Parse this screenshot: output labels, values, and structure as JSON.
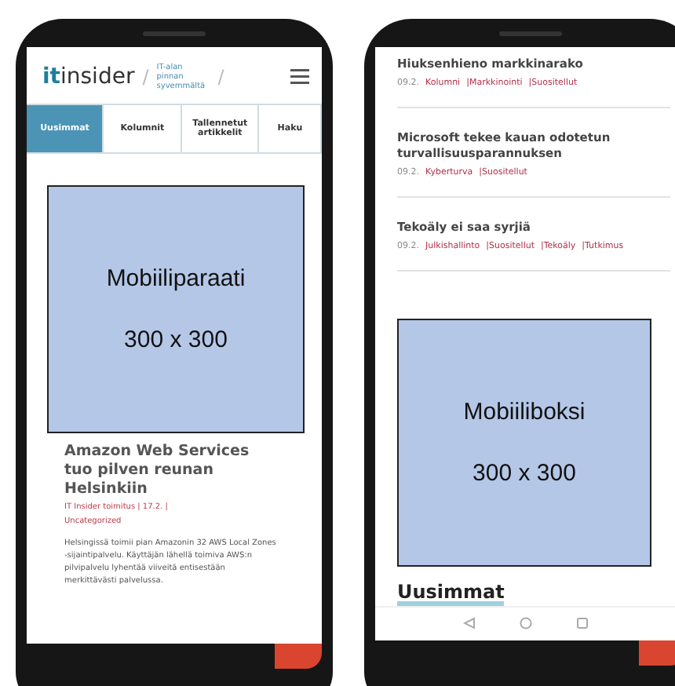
{
  "left_phone": {
    "header": {
      "logo_mark": "it",
      "logo_word": "insider",
      "separators": [
        "/",
        "/"
      ],
      "tagline": "IT-alan pinnan syvemmältä"
    },
    "tabs": [
      {
        "label": "Uusimmat",
        "selected": true
      },
      {
        "label": "Kolumnit",
        "selected": false
      },
      {
        "label": "Tallennetut artikkelit",
        "selected": false
      },
      {
        "label": "Haku",
        "selected": false
      }
    ],
    "ad": {
      "name": "Mobiiliparaati",
      "size": "300 x 300"
    },
    "article": {
      "title": "Amazon Web Services tuo pilven reunan Helsinkiin",
      "meta": "IT Insider toimitus | 17.2. |",
      "category": "Uncategorized",
      "excerpt": "Helsingissä toimii pian Amazonin 32 AWS Local Zones -sijaintipalvelu. Käyttäjän lähellä toimiva AWS:n pilvipalvelu lyhentää viiveitä entisestään merkittävästi palvelussa."
    }
  },
  "right_phone": {
    "articles": [
      {
        "title": "Hiuksenhieno markkinarako",
        "date": "09.2.",
        "tags": [
          "Kolumni",
          "|Markkinointi",
          "|Suositellut"
        ]
      },
      {
        "title": "Microsoft tekee kauan odotetun turvallisuusparannuksen",
        "date": "09.2.",
        "tags": [
          "Kyberturva",
          "|Suositellut"
        ]
      },
      {
        "title": "Tekoäly ei saa syrjiä",
        "date": "09.2.",
        "tags": [
          "Julkishallinto",
          "|Suositellut",
          "|Tekoäly",
          "|Tutkimus"
        ]
      }
    ],
    "ad": {
      "name": "Mobiiliboksi",
      "size": "300 x 300"
    },
    "section_heading": "Uusimmat"
  }
}
